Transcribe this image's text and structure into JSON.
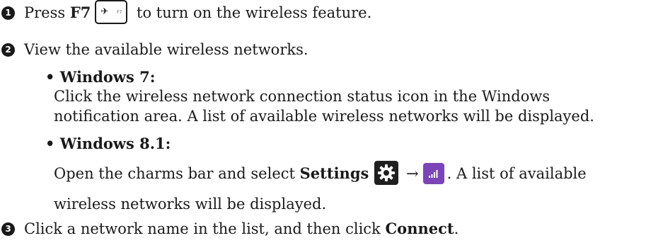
{
  "steps": [
    {
      "num": "1",
      "pre": "Press ",
      "key_label": "F7",
      "post": " to turn on the wireless feature."
    },
    {
      "num": "2",
      "text": "View the available wireless networks."
    },
    {
      "num": "3",
      "pre": "Click a network name in the list, and then click ",
      "bold": "Connect",
      "post": "."
    }
  ],
  "key": {
    "symbol": "✈",
    "fn": "F7",
    "icon": "airplane-icon"
  },
  "win7": {
    "heading": "Windows 7:",
    "line1": "Click the wireless network connection status icon in the Windows",
    "line2": "notification area. A list of available wireless networks will be displayed."
  },
  "win81": {
    "heading": "Windows 8.1:",
    "pre": "Open the charms bar and select ",
    "bold": "Settings",
    "arrow": "→",
    "post": ". A list of available",
    "line2": "wireless networks will be displayed.",
    "settings_icon": "gear-icon",
    "network_icon": "signal-bars-icon",
    "network_color": "#7b45b8"
  }
}
